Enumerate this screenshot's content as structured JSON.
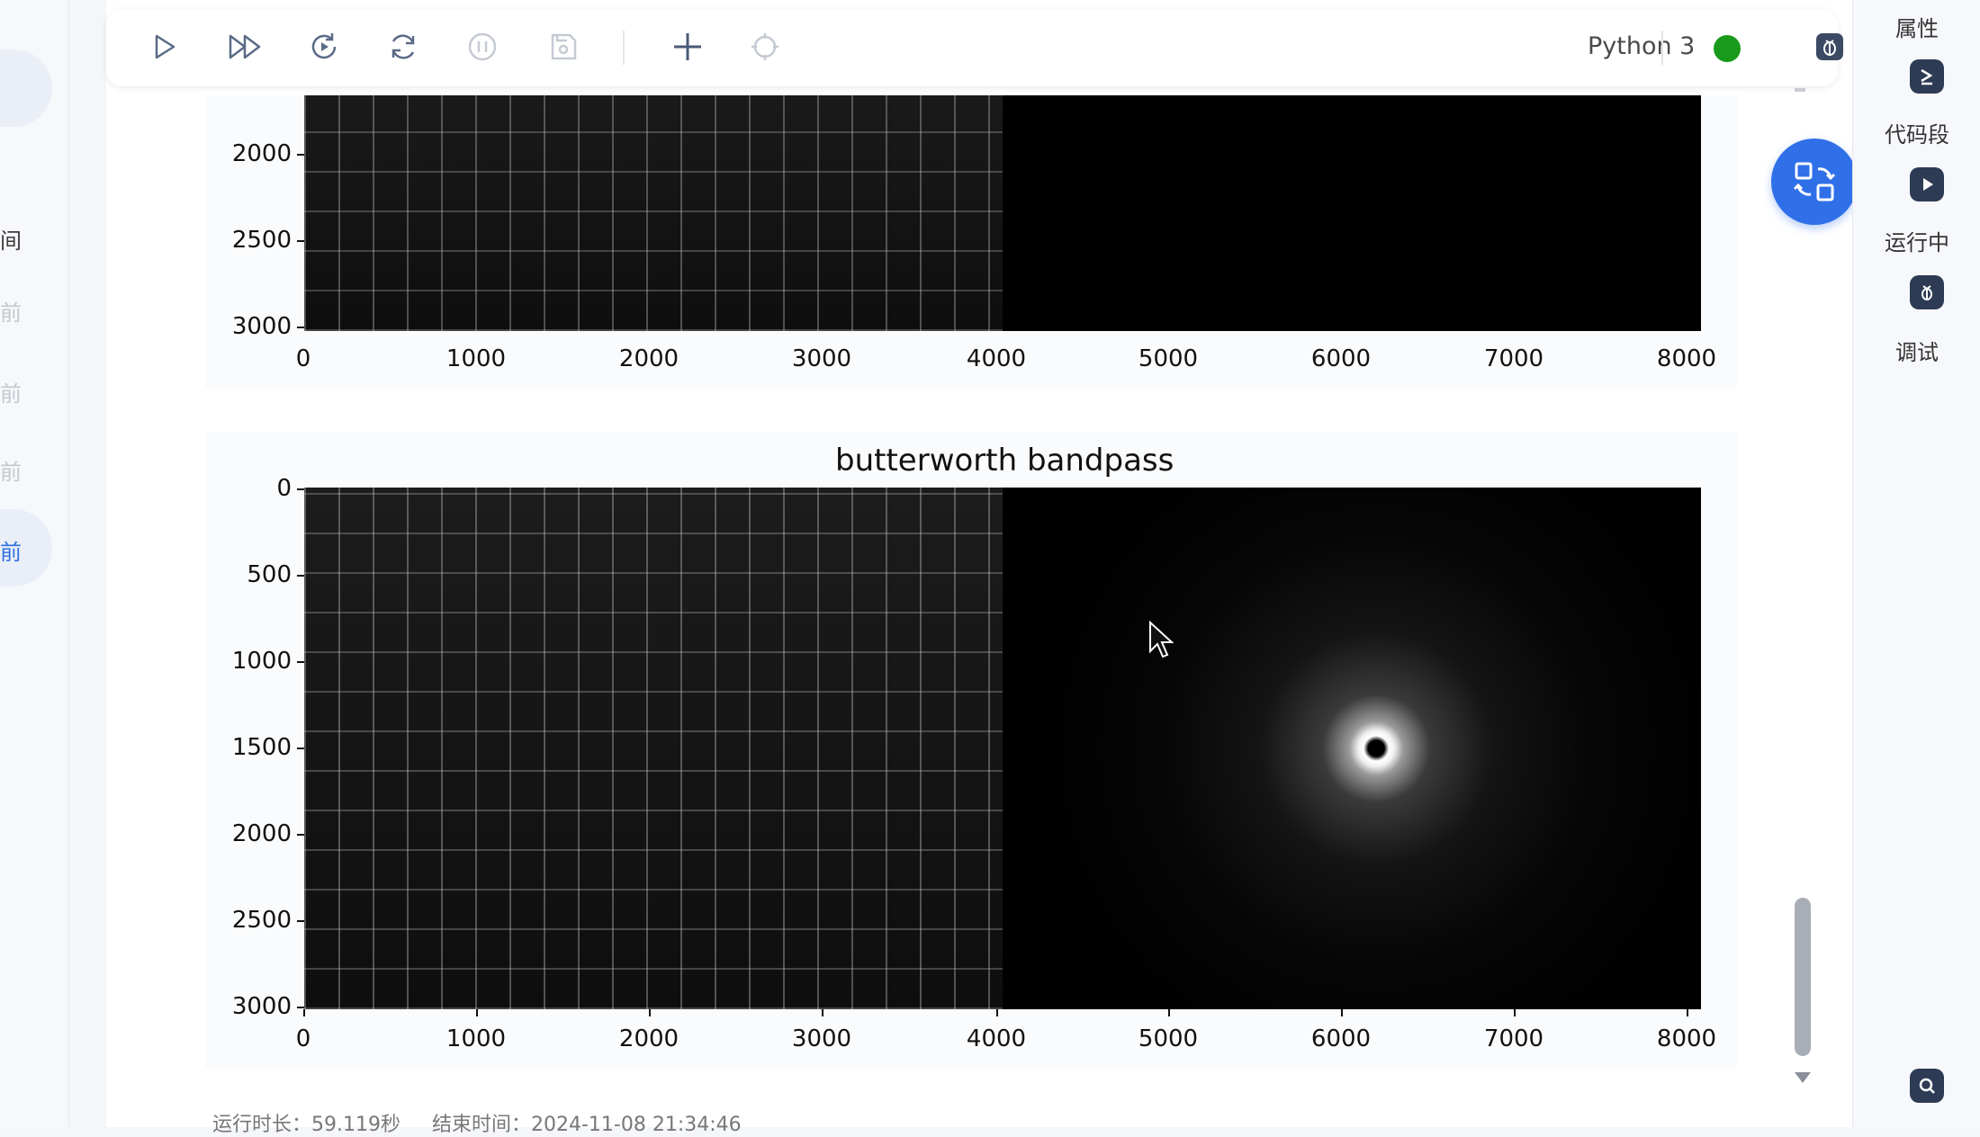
{
  "left_sidebar": {
    "items": [
      {
        "label": "间",
        "state": "normal"
      },
      {
        "label": "前",
        "state": "faded"
      },
      {
        "label": "前",
        "state": "faded"
      },
      {
        "label": "前",
        "state": "faded"
      },
      {
        "label": "前",
        "state": "active"
      }
    ]
  },
  "toolbar": {
    "buttons": [
      "run-icon",
      "run-all-icon",
      "restart-run-icon",
      "restart-icon",
      "interrupt-icon",
      "save-icon",
      "add-cell-icon",
      "target-icon"
    ],
    "kernel_label": "Python 3",
    "kernel_status_color": "#1a9a1a"
  },
  "outputs": [
    {
      "title": "",
      "y_ticks": [
        "2000",
        "2500",
        "3000"
      ],
      "x_ticks": [
        "0",
        "1000",
        "2000",
        "3000",
        "4000",
        "5000",
        "6000",
        "7000",
        "8000"
      ]
    },
    {
      "title": "butterworth bandpass",
      "y_ticks": [
        "0",
        "500",
        "1000",
        "1500",
        "2000",
        "2500",
        "3000"
      ],
      "x_ticks": [
        "0",
        "1000",
        "2000",
        "3000",
        "4000",
        "5000",
        "6000",
        "7000",
        "8000"
      ]
    }
  ],
  "chart_data": [
    {
      "type": "image",
      "title": "",
      "xlim": [
        0,
        8000
      ],
      "ylim_visible": [
        1700,
        3000
      ],
      "left_panel": "edge-filtered building image (grayscale)",
      "right_panel": "frequency response spectrum, black background"
    },
    {
      "type": "image",
      "title": "butterworth bandpass",
      "xlim": [
        0,
        8000
      ],
      "ylim": [
        0,
        3000
      ],
      "left_panel": "edge-filtered building image (grayscale)",
      "right_panel": "butterworth bandpass ring centered at x=6000, y=1500"
    }
  ],
  "status": {
    "runtime": "运行时长：59.119秒",
    "end_time": "结束时间：2024-11-08 21:34:46"
  },
  "right_panel": {
    "properties_label": "属性",
    "snippets_label": "代码段",
    "running_label": "运行中",
    "debug_label": "调试"
  },
  "colors": {
    "accent": "#2f6fe8",
    "kernel_ok": "#1a9a1a"
  }
}
